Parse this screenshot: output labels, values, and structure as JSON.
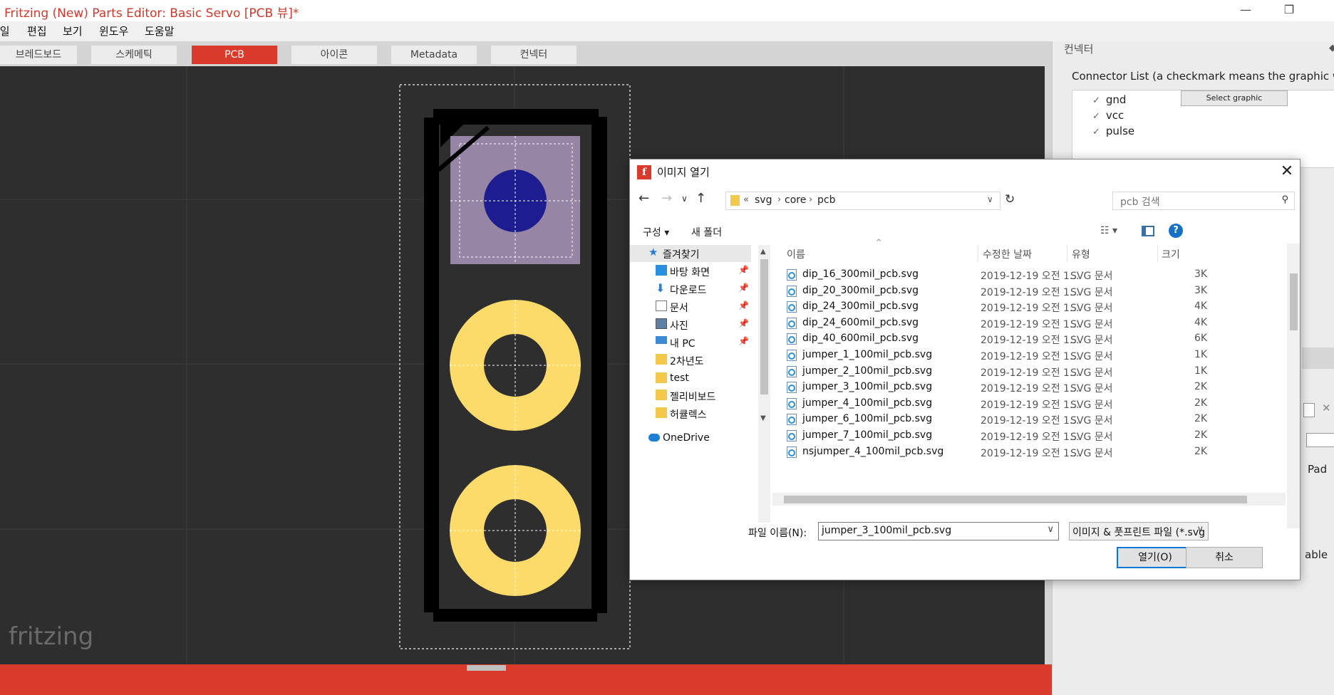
{
  "window": {
    "title": "Fritzing (New) Parts Editor: Basic Servo [PCB 뷰]*"
  },
  "menu": [
    "파일",
    "편집",
    "보기",
    "윈도우",
    "도움말"
  ],
  "tabs": [
    {
      "label": "브레드보드"
    },
    {
      "label": "스케메틱"
    },
    {
      "label": "PCB",
      "active": true
    },
    {
      "label": "아이콘"
    },
    {
      "label": "Metadata"
    },
    {
      "label": "컨넥터"
    }
  ],
  "canvas": {
    "watermark": "fritzing"
  },
  "connector_panel": {
    "title": "컨넥터",
    "hint": "Connector List (a checkmark means the graphic was sel",
    "connectors": [
      "gnd",
      "vcc",
      "pulse"
    ],
    "select_graphic": "Select graphic",
    "pad_label": "Pad",
    "able_label": "able"
  },
  "dialog": {
    "title": "이미지 열기",
    "path": [
      "svg",
      "core",
      "pcb"
    ],
    "search_placeholder": "pcb 검색",
    "toolbar": {
      "organize": "구성 ▾",
      "new_folder": "새 폴더"
    },
    "tree": [
      {
        "label": "즐겨찾기",
        "icon": "star-icon",
        "selected": true
      },
      {
        "label": "바탕 화면",
        "icon": "desktop-icon",
        "pinned": true
      },
      {
        "label": "다운로드",
        "icon": "download-icon",
        "pinned": true
      },
      {
        "label": "문서",
        "icon": "document-icon",
        "pinned": true
      },
      {
        "label": "사진",
        "icon": "picture-icon",
        "pinned": true
      },
      {
        "label": "내 PC",
        "icon": "pc-icon",
        "pinned": true
      },
      {
        "label": "2차년도",
        "icon": "folder-icon"
      },
      {
        "label": "test",
        "icon": "folder-icon"
      },
      {
        "label": "젤리비보드",
        "icon": "folder-icon"
      },
      {
        "label": "허큘렉스",
        "icon": "folder-icon"
      },
      {
        "label": "OneDrive",
        "icon": "cloud-icon"
      }
    ],
    "columns": [
      "이름",
      "수정한 날짜",
      "유형",
      "크기"
    ],
    "files": [
      {
        "name": "dip_16_300mil_pcb.svg",
        "date": "2019-12-19 오전 1...",
        "type": "SVG 문서",
        "size": "3K"
      },
      {
        "name": "dip_20_300mil_pcb.svg",
        "date": "2019-12-19 오전 1...",
        "type": "SVG 문서",
        "size": "3K"
      },
      {
        "name": "dip_24_300mil_pcb.svg",
        "date": "2019-12-19 오전 1...",
        "type": "SVG 문서",
        "size": "4K"
      },
      {
        "name": "dip_24_600mil_pcb.svg",
        "date": "2019-12-19 오전 1...",
        "type": "SVG 문서",
        "size": "4K"
      },
      {
        "name": "dip_40_600mil_pcb.svg",
        "date": "2019-12-19 오전 1...",
        "type": "SVG 문서",
        "size": "6K"
      },
      {
        "name": "jumper_1_100mil_pcb.svg",
        "date": "2019-12-19 오전 1...",
        "type": "SVG 문서",
        "size": "1K"
      },
      {
        "name": "jumper_2_100mil_pcb.svg",
        "date": "2019-12-19 오전 1...",
        "type": "SVG 문서",
        "size": "1K"
      },
      {
        "name": "jumper_3_100mil_pcb.svg",
        "date": "2019-12-19 오전 1...",
        "type": "SVG 문서",
        "size": "2K"
      },
      {
        "name": "jumper_4_100mil_pcb.svg",
        "date": "2019-12-19 오전 1...",
        "type": "SVG 문서",
        "size": "2K"
      },
      {
        "name": "jumper_6_100mil_pcb.svg",
        "date": "2019-12-19 오전 1...",
        "type": "SVG 문서",
        "size": "2K"
      },
      {
        "name": "jumper_7_100mil_pcb.svg",
        "date": "2019-12-19 오전 1...",
        "type": "SVG 문서",
        "size": "2K"
      },
      {
        "name": "nsjumper_4_100mil_pcb.svg",
        "date": "2019-12-19 오전 1...",
        "type": "SVG 문서",
        "size": "2K"
      }
    ],
    "filename_label": "파일 이름(N):",
    "filename_value": "jumper_3_100mil_pcb.svg",
    "filetype_value": "이미지 & 풋프린트 파일 (*.svg",
    "open_button": "열기(O)",
    "cancel_button": "취소"
  },
  "colors": {
    "accent": "#d93a2b",
    "canvas_bg": "#2e2e2e",
    "pad_gold": "#fcdb6a",
    "square_pad": "#9685a5",
    "hole_blue": "#1d1d8f"
  }
}
